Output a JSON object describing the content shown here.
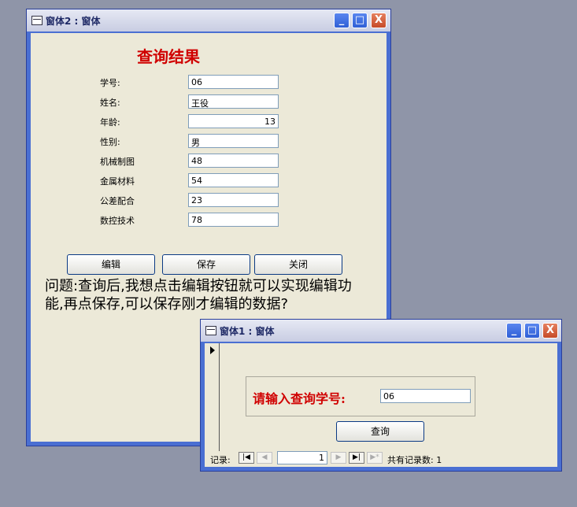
{
  "form2": {
    "title": "窗体2 : 窗体",
    "heading": "查询结果",
    "fields": [
      {
        "label": "学号:",
        "value": "06"
      },
      {
        "label": "姓名:",
        "value": "王役"
      },
      {
        "label": "年龄:",
        "value": "13"
      },
      {
        "label": "性别:",
        "value": "男"
      },
      {
        "label": "机械制图",
        "value": "48"
      },
      {
        "label": "金属材料",
        "value": "54"
      },
      {
        "label": "公差配合",
        "value": "23"
      },
      {
        "label": "数控技术",
        "value": "78"
      }
    ],
    "buttons": {
      "edit": "编辑",
      "save": "保存",
      "close": "关闭"
    },
    "question": "问题:查询后,我想点击编辑按钮就可以实现编辑功能,再点保存,可以保存刚才编辑的数据?"
  },
  "form1": {
    "title": "窗体1 : 窗体",
    "prompt_label": "请输入查询学号:",
    "input_value": "06",
    "query_button": "查询",
    "nav": {
      "label": "记录:",
      "current_record": "1",
      "total_text": "共有记录数: 1"
    }
  },
  "window_controls": {
    "minimize": "_",
    "maximize": "□",
    "close": "X"
  },
  "colors": {
    "title_red": "#d00000",
    "xp_blue": "#4a6fd2",
    "client_bg": "#ece9d8"
  }
}
